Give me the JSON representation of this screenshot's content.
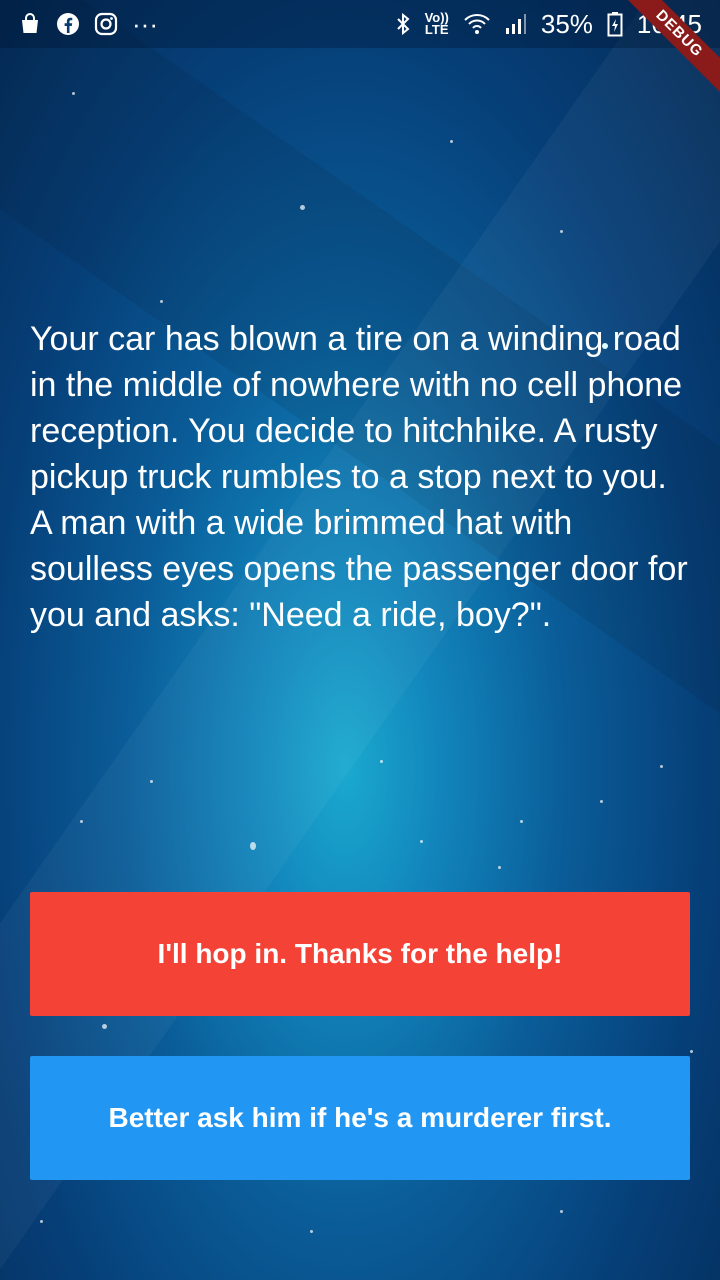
{
  "status_bar": {
    "left_icons": [
      "shopping-bag-icon",
      "facebook-icon",
      "instagram-icon",
      "more-dots-icon"
    ],
    "more_dots": "···",
    "volte_top": "Vo))",
    "volte_bottom": "LTE",
    "battery_percent": "35%",
    "time": "16:45",
    "right_icons": [
      "bluetooth-icon",
      "volte-icon",
      "wifi-icon",
      "signal-icon",
      "battery-icon"
    ]
  },
  "debug_banner": "DEBUG",
  "story": {
    "text": "Your car has blown a tire on a winding road in the middle of nowhere with no cell phone reception. You decide to hitchhike. A rusty pickup truck rumbles to a stop next to you. A man with a wide brimmed hat with soulless eyes opens the passenger door for you and asks: \"Need a ride, boy?\"."
  },
  "choices": [
    {
      "label": "I'll hop in. Thanks for the help!",
      "color": "#f44336"
    },
    {
      "label": "Better ask him if he's a murderer first.",
      "color": "#2196f3"
    }
  ],
  "colors": {
    "background_center": "#1aa9cf",
    "background_edge": "#042a55",
    "debug_ribbon": "#8b1a1a"
  }
}
